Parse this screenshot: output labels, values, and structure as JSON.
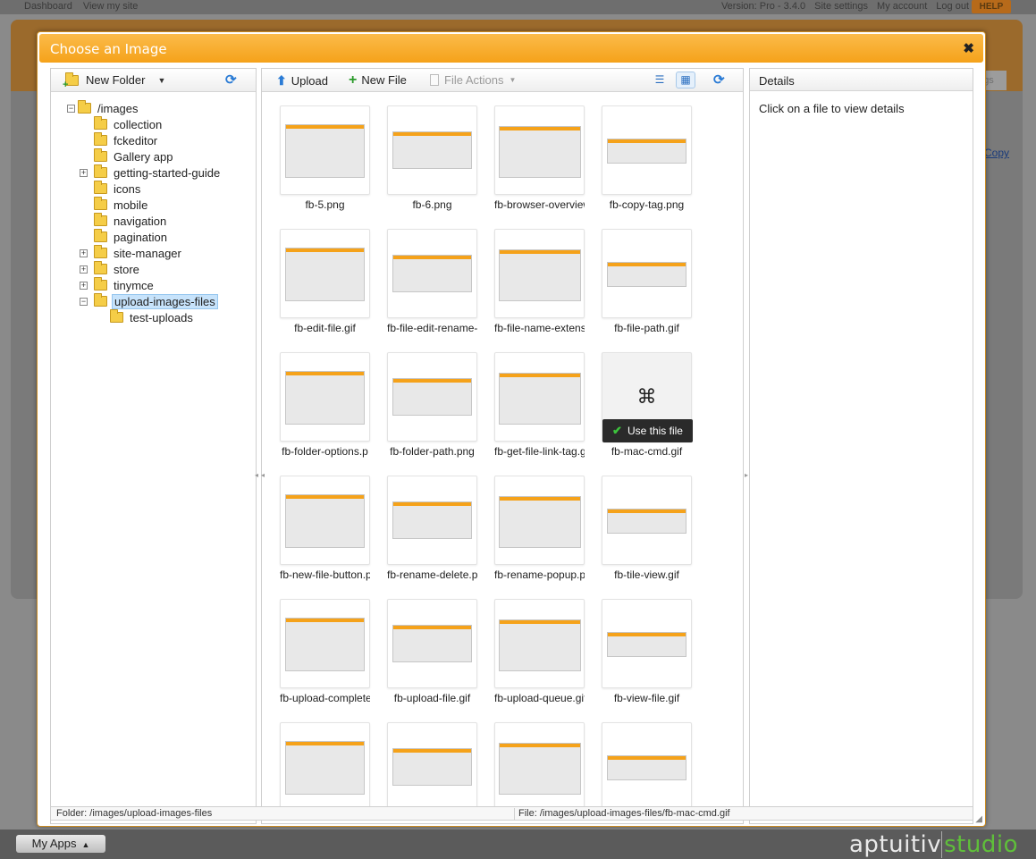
{
  "topbar": {
    "left_links": [
      "Dashboard",
      "View my site"
    ],
    "right_links": [
      "Version: Pro - 3.4.0",
      "Site settings",
      "My account",
      "Log out"
    ],
    "help_label": "HELP"
  },
  "background": {
    "copy_link": "Copy"
  },
  "dialog": {
    "title": "Choose an Image",
    "close_glyph": "✖"
  },
  "tree_toolbar": {
    "new_folder_label": "New Folder"
  },
  "tree": [
    {
      "label": "/images",
      "toggle": "−",
      "expanded": true
    },
    {
      "label": "collection"
    },
    {
      "label": "fckeditor"
    },
    {
      "label": "Gallery app"
    },
    {
      "label": "getting-started-guide",
      "toggle": "+"
    },
    {
      "label": "icons"
    },
    {
      "label": "mobile"
    },
    {
      "label": "navigation"
    },
    {
      "label": "pagination"
    },
    {
      "label": "site-manager",
      "toggle": "+"
    },
    {
      "label": "store",
      "toggle": "+"
    },
    {
      "label": "tinymce",
      "toggle": "+"
    },
    {
      "label": "upload-images-files",
      "toggle": "−",
      "selected": true
    },
    {
      "label": "test-uploads"
    }
  ],
  "files_toolbar": {
    "upload_label": "Upload",
    "new_file_label": "New File",
    "file_actions_label": "File Actions"
  },
  "files": [
    {
      "name": "fb-5.png"
    },
    {
      "name": "fb-6.png"
    },
    {
      "name": "fb-browser-overview"
    },
    {
      "name": "fb-copy-tag.png"
    },
    {
      "name": "fb-edit-file.gif"
    },
    {
      "name": "fb-file-edit-rename-"
    },
    {
      "name": "fb-file-name-extens"
    },
    {
      "name": "fb-file-path.gif"
    },
    {
      "name": "fb-folder-options.p"
    },
    {
      "name": "fb-folder-path.png"
    },
    {
      "name": "fb-get-file-link-tag.g"
    },
    {
      "name": "fb-mac-cmd.gif",
      "hover": true,
      "glyph": "⌘",
      "action_label": "Use this file"
    },
    {
      "name": "fb-new-file-button.p"
    },
    {
      "name": "fb-rename-delete.p"
    },
    {
      "name": "fb-rename-popup.p"
    },
    {
      "name": "fb-tile-view.gif"
    },
    {
      "name": "fb-upload-complete"
    },
    {
      "name": "fb-upload-file.gif"
    },
    {
      "name": "fb-upload-queue.gif"
    },
    {
      "name": "fb-view-file.gif"
    },
    {
      "name": ""
    },
    {
      "name": ""
    },
    {
      "name": ""
    },
    {
      "name": ""
    }
  ],
  "details": {
    "title": "Details",
    "hint": "Click on a file to view details"
  },
  "status": {
    "folder": "Folder:  /images/upload-images-files",
    "file": "File:  /images/upload-images-files/fb-mac-cmd.gif"
  },
  "bottom": {
    "my_apps_label": "My Apps",
    "brand_left": "aptuitiv",
    "brand_right": "studio"
  },
  "colors": {
    "header_orange": "#f5a21a",
    "selection_blue": "#c7e3fb",
    "brand_green": "#5fbf3a"
  }
}
